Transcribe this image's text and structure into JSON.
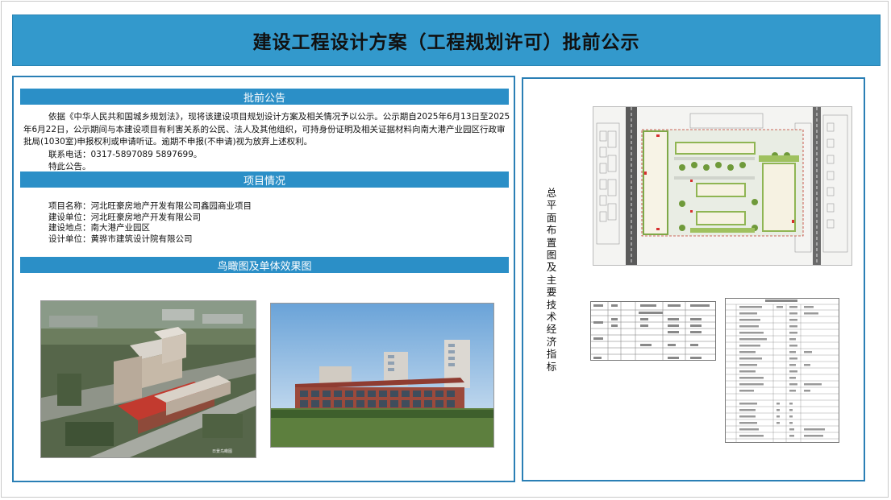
{
  "title": "建设工程设计方案（工程规划许可）批前公示",
  "notice": {
    "header": "批前公告",
    "paragraph": "依据《中华人民共和国城乡规划法》，现将该建设项目规划设计方案及相关情况予以公示。公示期自2025年6月13日至2025年6月22日，公示期间与本建设项目有利害关系的公民、法人及其他组织，可持身份证明及相关证据材料向南大港产业园区行政审批局(1030室)申报权利或申请听证。逾期不申报(不申请)视为放弃上述权利。",
    "phone": "联系电话：0317-5897089 5897699。",
    "closing": "特此公告。"
  },
  "project": {
    "header": "项目情况",
    "name": "项目名称：河北旺豪房地产开发有限公司鑫园商业项目",
    "developer": "建设单位：河北旺豪房地产开发有限公司",
    "location": "建设地点：南大港产业园区",
    "designer": "设计单位：黄骅市建筑设计院有限公司"
  },
  "renderings": {
    "header": "鸟瞰图及单体效果图",
    "aerial_caption": "日景鸟瞰图"
  },
  "right": {
    "vertical_title": "总平面布置图及主要技术经济指标"
  },
  "colors": {
    "title_bar": "#3399cc",
    "section_header": "#2b8fc7",
    "panel_border": "#2a7fb5"
  }
}
